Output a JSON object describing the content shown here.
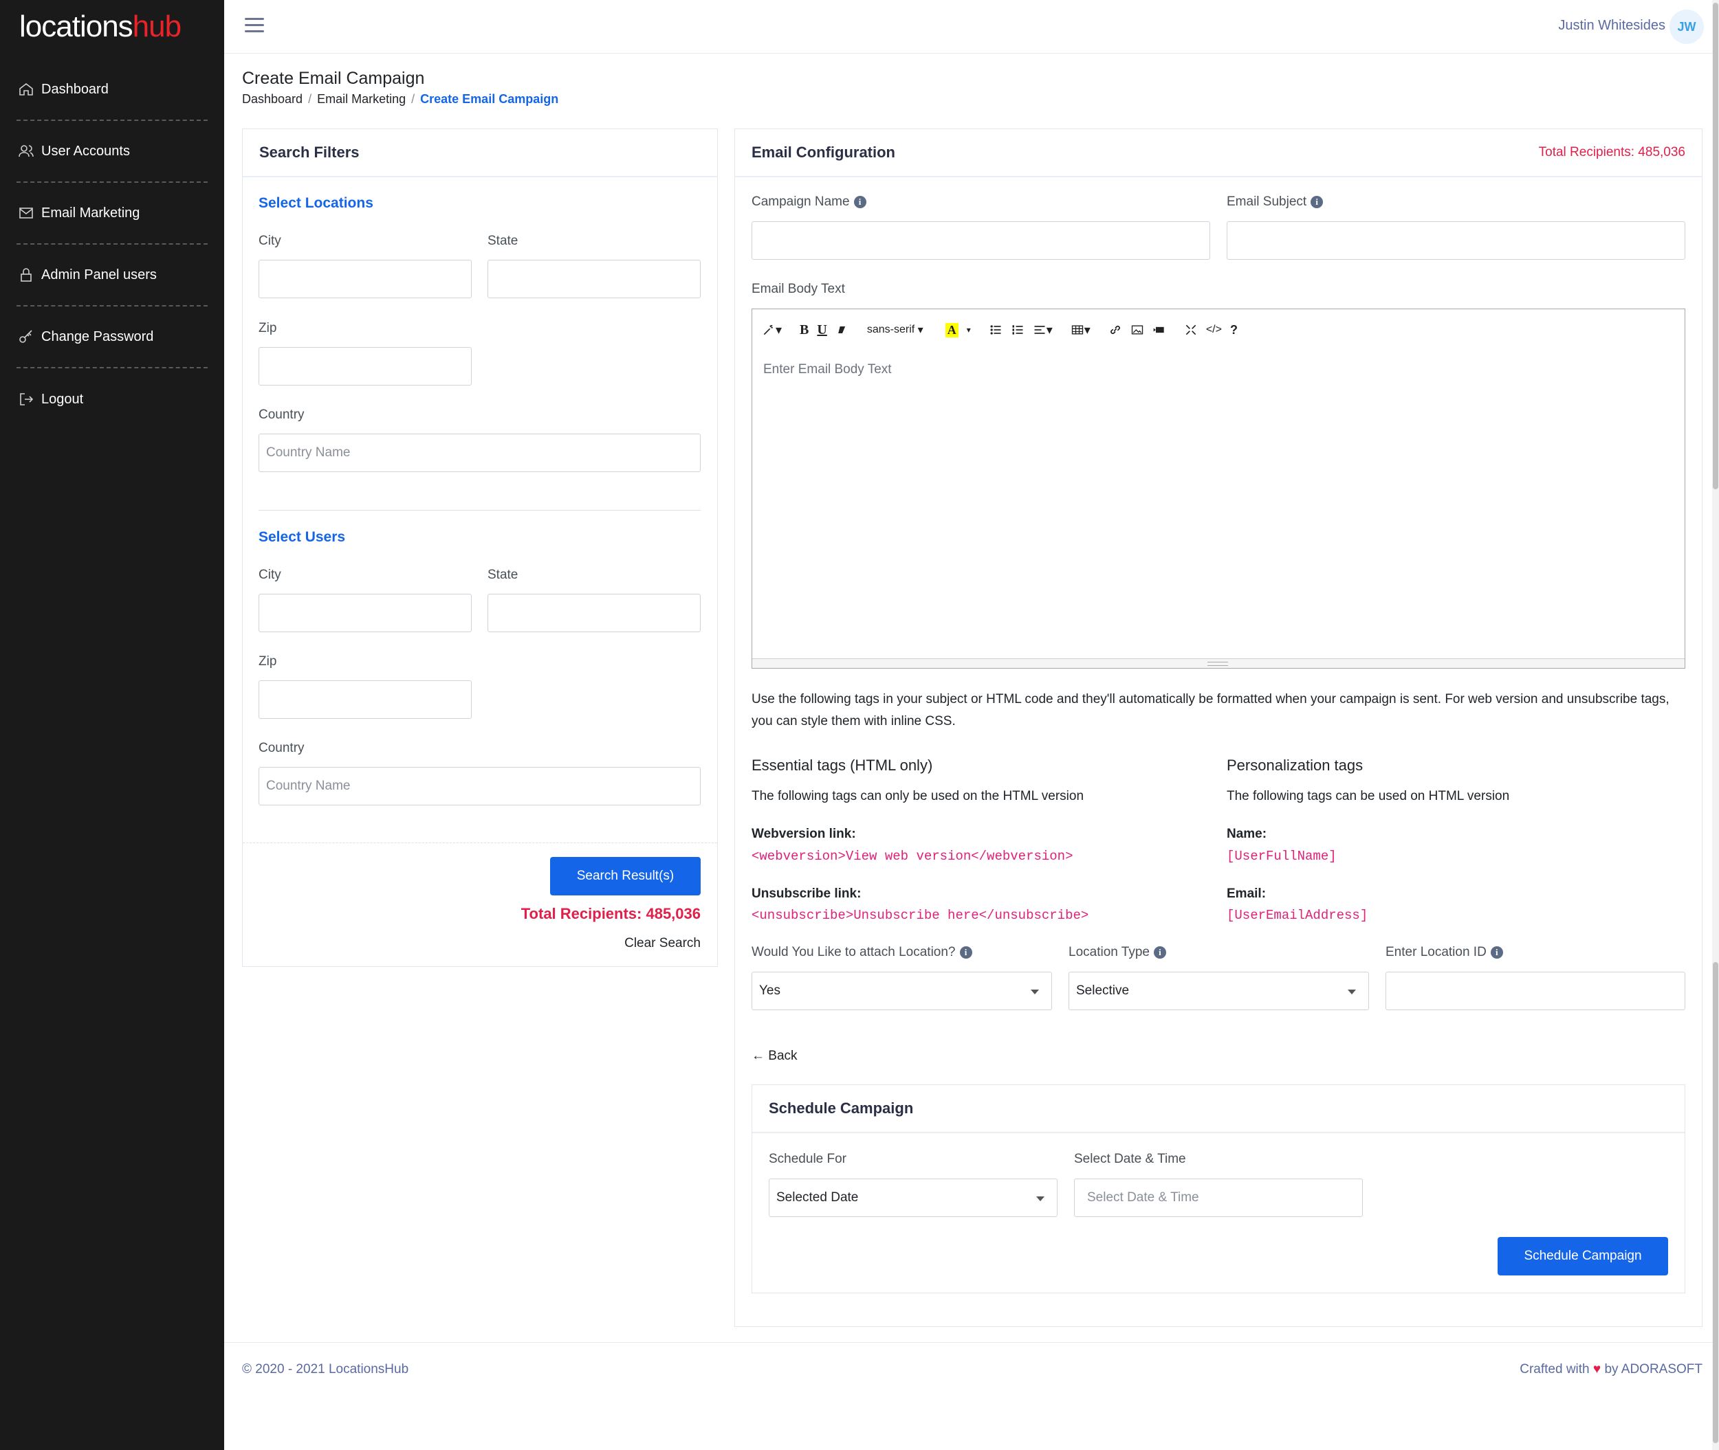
{
  "brand": {
    "part1": "locations",
    "part2": "hub"
  },
  "sidebar": {
    "items": [
      {
        "label": "Dashboard",
        "icon": "home-icon"
      },
      {
        "label": "User Accounts",
        "icon": "users-icon"
      },
      {
        "label": "Email Marketing",
        "icon": "mail-icon"
      },
      {
        "label": "Admin Panel users",
        "icon": "lock-icon"
      },
      {
        "label": "Change Password",
        "icon": "key-icon"
      },
      {
        "label": "Logout",
        "icon": "logout-icon"
      }
    ]
  },
  "topbar": {
    "user_name": "Justin Whitesides",
    "initials": "JW"
  },
  "header": {
    "title": "Create Email Campaign",
    "breadcrumb": [
      "Dashboard",
      "Email Marketing",
      "Create Email Campaign"
    ]
  },
  "filters": {
    "title": "Search Filters",
    "locations": {
      "title": "Select Locations",
      "city_label": "City",
      "state_label": "State",
      "zip_label": "Zip",
      "country_label": "Country",
      "country_placeholder": "Country Name"
    },
    "users": {
      "title": "Select Users",
      "city_label": "City",
      "state_label": "State",
      "zip_label": "Zip",
      "country_label": "Country",
      "country_placeholder": "Country Name"
    },
    "search_button": "Search Result(s)",
    "total": "Total Recipients: 485,036",
    "clear": "Clear Search"
  },
  "config": {
    "title": "Email Configuration",
    "total": "Total Recipients: 485,036",
    "campaign_name_label": "Campaign Name",
    "email_subject_label": "Email Subject",
    "body_label": "Email Body Text",
    "body_placeholder": "Enter Email Body Text",
    "font_name": "sans-serif",
    "help_text": "Use the following tags in your subject or HTML code and they'll automatically be formatted when your campaign is sent. For web version and unsubscribe tags, you can style them with inline CSS.",
    "essential": {
      "title": "Essential tags (HTML only)",
      "desc": "The following tags can only be used on the HTML version",
      "web_label": "Webversion link:",
      "web_code": "<webversion>View web version</webversion>",
      "unsub_label": "Unsubscribe link:",
      "unsub_code": "<unsubscribe>Unsubscribe here</unsubscribe>"
    },
    "personal": {
      "title": "Personalization tags",
      "desc": "The following tags can be used on HTML version",
      "name_label": "Name:",
      "name_code": "[UserFullName]",
      "email_label": "Email:",
      "email_code": "[UserEmailAddress]"
    },
    "attach_label": "Would You Like to attach Location?",
    "attach_value": "Yes",
    "loc_type_label": "Location Type",
    "loc_type_value": "Selective",
    "loc_id_label": "Enter Location ID",
    "back": "Back"
  },
  "schedule": {
    "title": "Schedule Campaign",
    "for_label": "Schedule For",
    "for_value": "Selected Date",
    "date_label": "Select Date & Time",
    "date_placeholder": "Select Date & Time",
    "button": "Schedule Campaign"
  },
  "footer": {
    "left": "© 2020 - 2021 LocationsHub",
    "right_pre": "Crafted with",
    "right_post": "by ADORASOFT"
  },
  "colors": {
    "primary": "#1565e8",
    "accent_red": "#e0204a",
    "sidebar_bg": "#1a1a1a",
    "code_pink": "#e0207a"
  }
}
